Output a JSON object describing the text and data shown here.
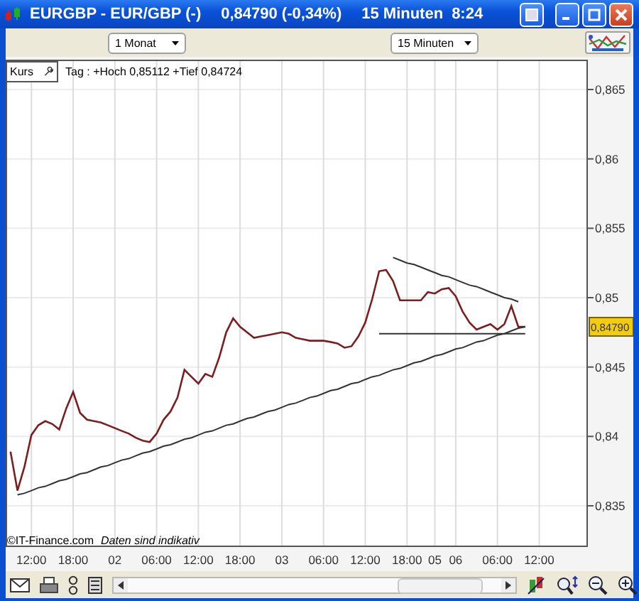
{
  "window": {
    "symbol": "EURGBP - EUR/GBP (-)",
    "quote": "0,84790 (-0,34%)",
    "interval": "15 Minuten",
    "time": "8:24"
  },
  "toolbar": {
    "range_select": {
      "value": "1 Monat"
    },
    "interval_select": {
      "value": "15 Minuten"
    }
  },
  "legend": {
    "summary": "Tag : +Hoch 0,85112 +Tief 0,84724"
  },
  "price_tag": {
    "label": "0,84790"
  },
  "footer_note": {
    "source": "©IT-Finance.com",
    "disclaimer": "Daten sind indikativ"
  },
  "chart_data": {
    "type": "line",
    "categories": [
      null,
      null,
      null,
      "12:00",
      null,
      null,
      null,
      null,
      null,
      "18:00",
      null,
      null,
      null,
      null,
      null,
      "02",
      null,
      null,
      null,
      null,
      null,
      "06:00",
      null,
      null,
      null,
      null,
      null,
      "12:00",
      null,
      null,
      null,
      null,
      null,
      "18:00",
      null,
      null,
      null,
      null,
      null,
      "03",
      null,
      null,
      null,
      null,
      null,
      "06:00",
      null,
      null,
      null,
      null,
      null,
      "12:00",
      null,
      null,
      null,
      null,
      null,
      "18:00",
      null,
      null,
      null,
      "05",
      null,
      null,
      "06",
      null,
      null,
      null,
      null,
      null,
      "06:00",
      null,
      null,
      null,
      null,
      null,
      "12:00",
      null,
      null,
      null,
      null,
      null,
      null,
      null
    ],
    "series": [
      {
        "name": "Kurs",
        "color": "#7a1f1f",
        "values": [
          0.8389,
          0.8361,
          0.8378,
          0.8401,
          0.8408,
          0.8411,
          0.8409,
          0.8405,
          0.842,
          0.8432,
          0.8417,
          0.8412,
          0.8411,
          0.841,
          0.8408,
          0.8406,
          0.8404,
          0.8402,
          0.8399,
          0.8397,
          0.8396,
          0.8402,
          0.8412,
          0.8418,
          0.8428,
          0.8448,
          0.8443,
          0.8438,
          0.8445,
          0.8443,
          0.8457,
          0.8475,
          0.8485,
          0.8479,
          0.8475,
          0.8471,
          0.8472,
          0.8473,
          0.8474,
          0.8475,
          0.8474,
          0.8471,
          0.847,
          0.8469,
          0.8469,
          0.8469,
          0.8468,
          0.8467,
          0.8464,
          0.8465,
          0.8472,
          0.8482,
          0.8499,
          0.8519,
          0.852,
          0.8512,
          0.8498,
          0.8498,
          0.8498,
          0.8498,
          0.8504,
          0.8503,
          0.8506,
          0.8507,
          0.8501,
          0.849,
          0.8482,
          0.8477,
          0.8479,
          0.8481,
          0.8477,
          0.8481,
          0.8494,
          0.8479,
          0.8479,
          null,
          null,
          null,
          null,
          null,
          null,
          null,
          null,
          null
        ]
      },
      {
        "color": "#333333",
        "values": [
          null,
          0.8358,
          0.8359,
          0.8361,
          0.8363,
          0.8364,
          0.8366,
          0.8368,
          0.8369,
          0.8371,
          0.8373,
          0.8374,
          0.8376,
          0.8378,
          0.8379,
          0.8381,
          0.8383,
          0.8384,
          0.8386,
          0.8388,
          0.8389,
          0.8391,
          0.8393,
          0.8394,
          0.8396,
          0.8398,
          0.8399,
          0.8401,
          0.8403,
          0.8404,
          0.8406,
          0.8408,
          0.8409,
          0.8411,
          0.8413,
          0.8414,
          0.8416,
          0.8418,
          0.8419,
          0.8421,
          0.8423,
          0.8424,
          0.8426,
          0.8428,
          0.8429,
          0.8431,
          0.8433,
          0.8434,
          0.8436,
          0.8438,
          0.8439,
          0.8441,
          0.8443,
          0.8444,
          0.8446,
          0.8448,
          0.8449,
          0.8451,
          0.8453,
          0.8454,
          0.8456,
          0.8458,
          0.8459,
          0.8461,
          0.8463,
          0.8464,
          0.8466,
          0.8468,
          0.8469,
          0.8471,
          0.8473,
          0.8474,
          0.8476,
          0.8478,
          0.8479,
          null,
          null,
          null,
          null,
          null,
          null,
          null,
          null,
          null
        ]
      },
      {
        "color": "#333333",
        "values": [
          null,
          null,
          null,
          null,
          null,
          null,
          null,
          null,
          null,
          null,
          null,
          null,
          null,
          null,
          null,
          null,
          null,
          null,
          null,
          null,
          null,
          null,
          null,
          null,
          null,
          null,
          null,
          null,
          null,
          null,
          null,
          null,
          null,
          null,
          null,
          null,
          null,
          null,
          null,
          null,
          null,
          null,
          null,
          null,
          null,
          null,
          null,
          null,
          null,
          null,
          null,
          null,
          null,
          null,
          null,
          0.8529,
          0.8527,
          0.8525,
          0.8524,
          0.8522,
          0.852,
          0.8518,
          0.8516,
          0.8515,
          0.8513,
          0.8511,
          0.8509,
          0.8508,
          0.8506,
          0.8504,
          0.8502,
          0.85,
          0.8499,
          0.8497,
          null,
          null,
          null,
          null,
          null,
          null,
          null,
          null,
          null,
          null
        ]
      },
      {
        "color": "#333333",
        "values": [
          null,
          null,
          null,
          null,
          null,
          null,
          null,
          null,
          null,
          null,
          null,
          null,
          null,
          null,
          null,
          null,
          null,
          null,
          null,
          null,
          null,
          null,
          null,
          null,
          null,
          null,
          null,
          null,
          null,
          null,
          null,
          null,
          null,
          null,
          null,
          null,
          null,
          null,
          null,
          null,
          null,
          null,
          null,
          null,
          null,
          null,
          null,
          null,
          null,
          null,
          null,
          null,
          null,
          0.8474,
          0.8474,
          0.8474,
          0.8474,
          0.8474,
          0.8474,
          0.8474,
          0.8474,
          0.8474,
          0.8474,
          0.8474,
          0.8474,
          0.8474,
          0.8474,
          0.8474,
          0.8474,
          0.8474,
          0.8474,
          0.8474,
          0.8474,
          0.8474,
          0.8474,
          null,
          null,
          null,
          null,
          null,
          null,
          null,
          null,
          null
        ]
      }
    ],
    "grid": true,
    "ylim": [
      0.83203,
      0.86715
    ],
    "yticks": [
      {
        "value": 0.835,
        "label": "0,835"
      },
      {
        "value": 0.84,
        "label": "0,84"
      },
      {
        "value": 0.845,
        "label": "0,845"
      },
      {
        "value": 0.85,
        "label": "0,85"
      },
      {
        "value": 0.855,
        "label": "0,855"
      },
      {
        "value": 0.86,
        "label": "0,86"
      },
      {
        "value": 0.865,
        "label": "0,865"
      }
    ]
  }
}
